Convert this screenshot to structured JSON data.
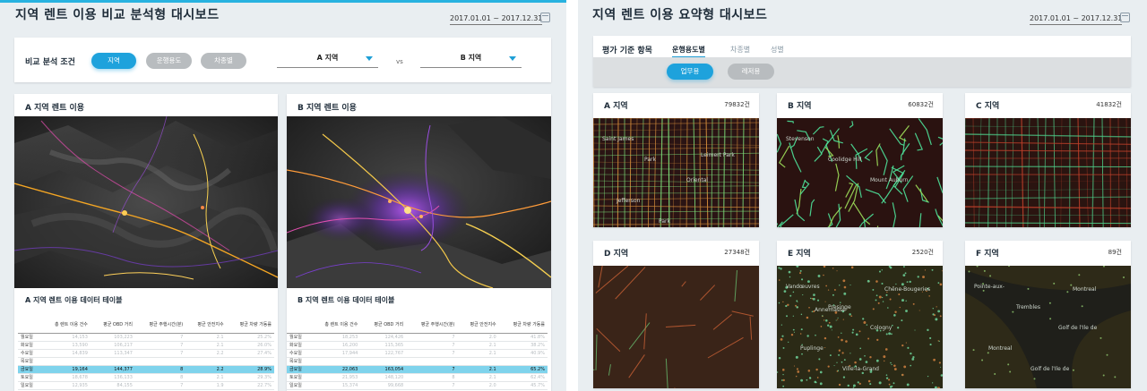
{
  "left": {
    "title": "지역 렌트 이용 비교 분석형 대시보드",
    "date_range": "2017.01.01 ~ 2017.12.31",
    "filter": {
      "label": "비교 분석 조건",
      "buttons": [
        "지역",
        "운행용도",
        "차종별"
      ],
      "select_a": "A 지역",
      "vs": "vs",
      "select_b": "B 지역"
    },
    "map_a_title": "A 지역 렌트 이용",
    "map_b_title": "B 지역 렌트 이용",
    "table_a_title": "A 지역 렌트 이용 데이터 테이블",
    "table_b_title": "B 지역 렌트 이용 데이터 테이블",
    "table_headers": [
      "",
      "총 렌트 이용 건수",
      "평균 OBD 거리",
      "평균 주행시간(분)",
      "평균 안전지수",
      "평균 차량 가동률"
    ],
    "table_a_rows": [
      [
        "월요일",
        "14,153",
        "103,223",
        "7",
        "2.1",
        "25.2%"
      ],
      [
        "화요일",
        "13,590",
        "106,217",
        "7",
        "2.1",
        "26.0%"
      ],
      [
        "수요일",
        "14,839",
        "113,347",
        "7",
        "2.2",
        "27.4%"
      ],
      [
        "목요일",
        "",
        "",
        "",
        "",
        ""
      ],
      [
        "금요일",
        "19,164",
        "144,377",
        "8",
        "2.2",
        "28.9%"
      ],
      [
        "토요일",
        "18,678",
        "136,133",
        "8",
        "2.1",
        "29.3%"
      ],
      [
        "일요일",
        "12,935",
        "84,155",
        "7",
        "1.9",
        "22.7%"
      ]
    ],
    "table_b_rows": [
      [
        "월요일",
        "18,253",
        "124,426",
        "7",
        "2.0",
        "41.8%"
      ],
      [
        "화요일",
        "16,200",
        "115,365",
        "7",
        "2.1",
        "38.2%"
      ],
      [
        "수요일",
        "17,944",
        "122,767",
        "7",
        "2.1",
        "40.9%"
      ],
      [
        "목요일",
        "",
        "",
        "",
        "",
        ""
      ],
      [
        "금요일",
        "22,063",
        "163,054",
        "7",
        "2.1",
        "65.2%"
      ],
      [
        "토요일",
        "21,953",
        "148,120",
        "8",
        "2.1",
        "62.4%"
      ],
      [
        "일요일",
        "15,374",
        "99,668",
        "7",
        "2.0",
        "45.7%"
      ]
    ]
  },
  "right": {
    "title": "지역 렌트 이용 요약형 대시보드",
    "date_range": "2017.01.01 ~ 2017.12.31",
    "criteria_label": "평가 기준 항목",
    "tabs": [
      "운행용도별",
      "차종별",
      "성별"
    ],
    "sub_buttons": [
      "업무용",
      "레저용"
    ],
    "regions": [
      {
        "name": "A 지역",
        "count": "79832건",
        "labels": [
          "Saint James",
          "Park",
          "Oriental",
          "Jefferson",
          "Park",
          "Leimert Park"
        ]
      },
      {
        "name": "B 지역",
        "count": "60832건",
        "labels": [
          "Stevenson",
          "Coolidge Hill",
          "Mount Auburn"
        ]
      },
      {
        "name": "C 지역",
        "count": "41832건",
        "labels": []
      },
      {
        "name": "D 지역",
        "count": "27348건",
        "labels": []
      },
      {
        "name": "E 지역",
        "count": "2520건",
        "labels": [
          "Vandœuvres",
          "Presinge",
          "Cologny",
          "Puplinge",
          "Ville-la-Grand",
          "Chêne-Bougeries",
          "Annemasse"
        ]
      },
      {
        "name": "F 지역",
        "count": "89건",
        "labels": [
          "Pointe-aux-",
          "Trembles",
          "Golf de l'Ile de",
          "Montreal",
          "Golf de l'Ile de",
          "Montreal"
        ]
      }
    ]
  }
}
